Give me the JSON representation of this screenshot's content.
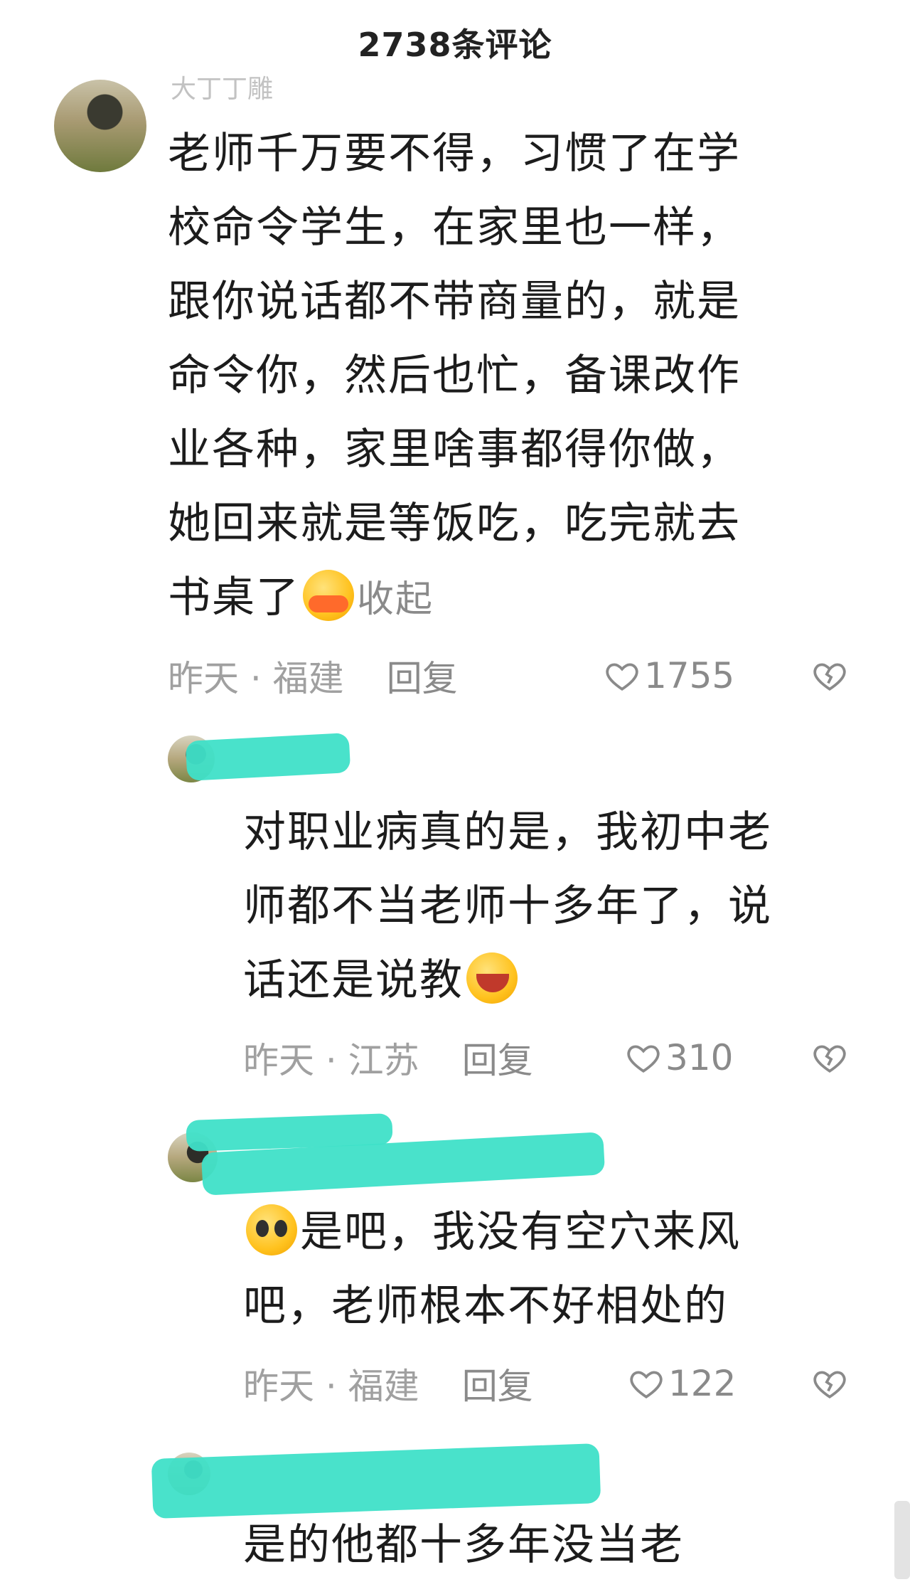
{
  "header": {
    "title": "2738条评论"
  },
  "comments": [
    {
      "username": "大丁丁雕",
      "text_lines": [
        "老师千万要不得，习惯了在学",
        "校命令学生，在家里也一样，",
        "跟你说话都不带商量的，就是",
        "命令你，然后也忙，备课改作",
        "业各种，家里啥事都得你做，",
        "她回来就是等饭吃，吃完就去",
        "书桌了"
      ],
      "collapse_label": "收起",
      "time_location": "昨天 · 福建",
      "reply_label": "回复",
      "likes": "1755"
    },
    {
      "username": "",
      "text_lines": [
        "对职业病真的是，我初中老",
        "师都不当老师十多年了，说",
        "话还是说教"
      ],
      "time_location": "昨天 · 江苏",
      "reply_label": "回复",
      "likes": "310"
    },
    {
      "username": "",
      "text_lines": [
        "是吧，我没有空穴来风",
        "吧，老师根本不好相处的"
      ],
      "time_location": "昨天 · 福建",
      "reply_label": "回复",
      "likes": "122"
    },
    {
      "username": "",
      "text_lines": [
        "是的他都十多年没当老"
      ]
    }
  ],
  "colors": {
    "redact": "#3fe0c8",
    "meta": "#a0a0a0",
    "text": "#1c1c1c"
  },
  "icons": {
    "like": "heart-outline-icon",
    "dislike": "broken-heart-icon"
  }
}
